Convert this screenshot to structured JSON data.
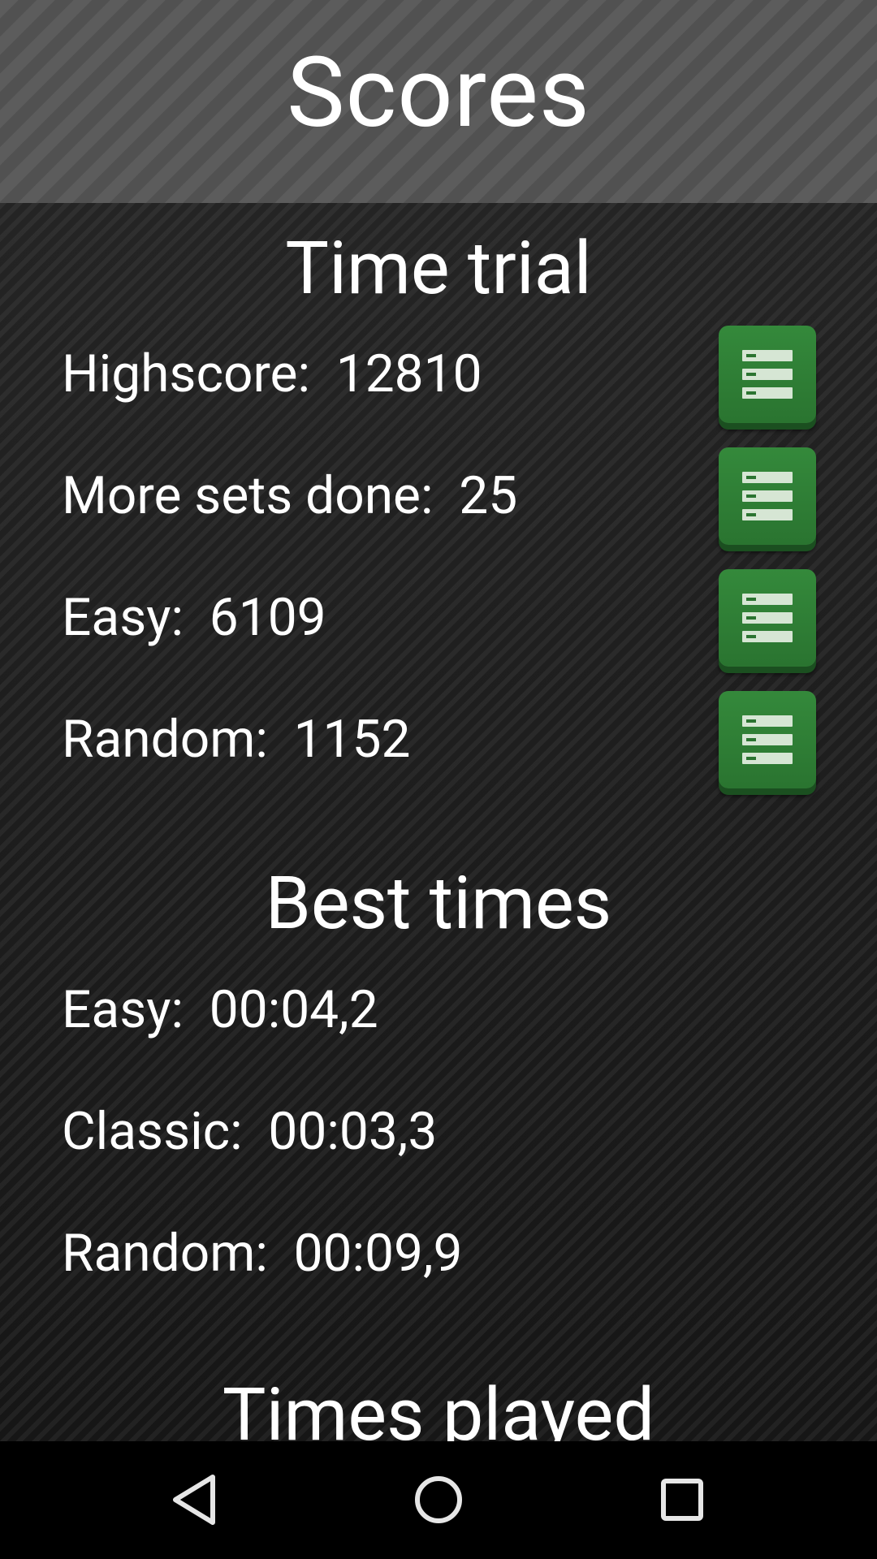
{
  "header": {
    "title": "Scores"
  },
  "time_trial": {
    "title": "Time trial",
    "rows": [
      {
        "text": "Highscore:  12810",
        "button": "leaderboard-icon"
      },
      {
        "text": "More sets done:  25",
        "button": "leaderboard-icon"
      },
      {
        "text": "Easy:  6109",
        "button": "leaderboard-icon"
      },
      {
        "text": "Random:  1152",
        "button": "leaderboard-icon"
      }
    ]
  },
  "best_times": {
    "title": "Best times",
    "rows": [
      {
        "text": "Easy:  00:04,2"
      },
      {
        "text": "Classic:  00:03,3"
      },
      {
        "text": "Random:  00:09,9"
      }
    ]
  },
  "times_played": {
    "title": "Times played"
  },
  "navbar": {
    "back": "back-icon",
    "home": "home-icon",
    "recent": "recents-icon"
  },
  "colors": {
    "button_green": "#2e7d32",
    "header_bg": "#555555",
    "text": "#ffffff"
  }
}
